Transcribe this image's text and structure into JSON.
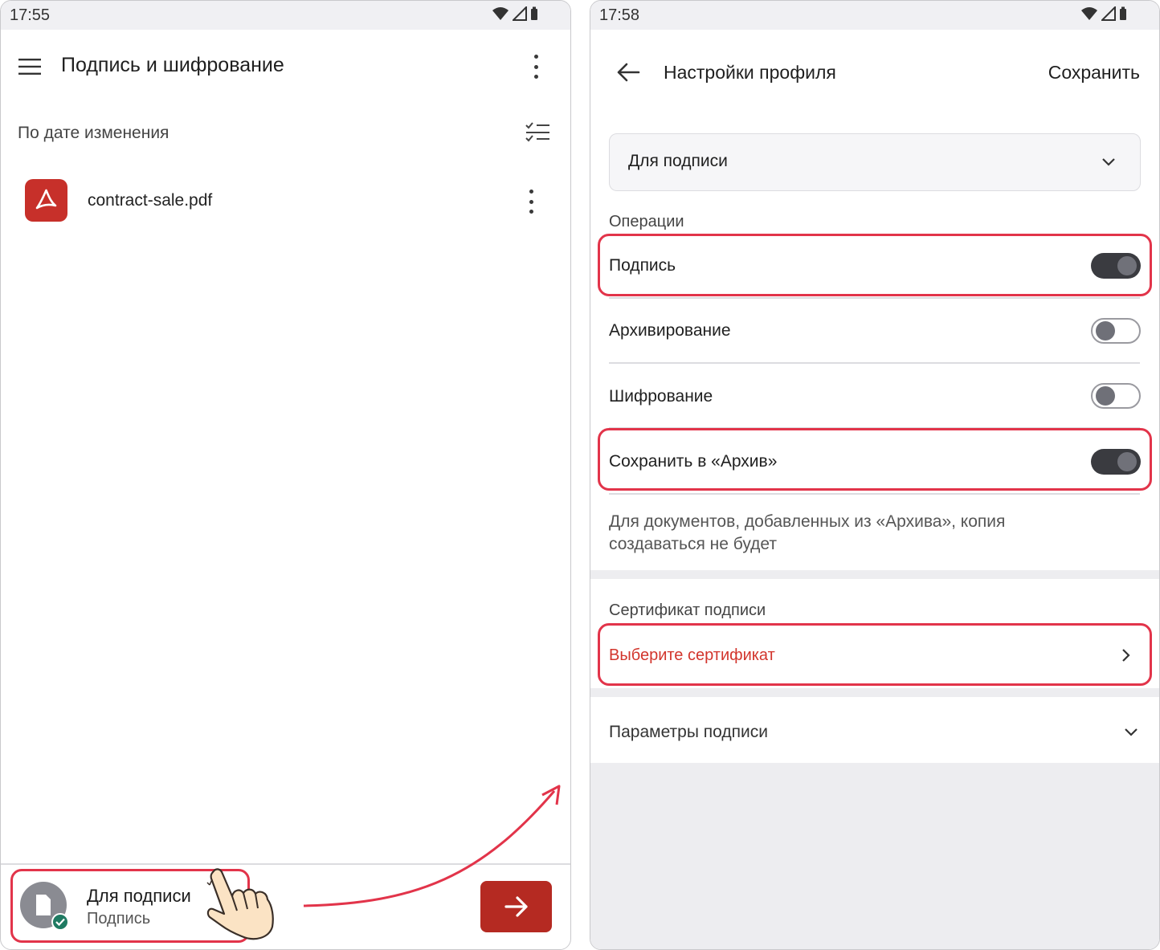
{
  "left": {
    "status_time": "17:55",
    "title": "Подпись и шифрование",
    "sort_label": "По дате изменения",
    "file_name": "contract-sale.pdf",
    "profile_name": "Для подписи",
    "profile_type": "Подпись"
  },
  "right": {
    "status_time": "17:58",
    "title": "Настройки профиля",
    "save_label": "Сохранить",
    "profile_select": "Для подписи",
    "operations_header": "Операции",
    "op_sign": "Подпись",
    "op_sign_enabled": true,
    "op_archive": "Архивирование",
    "op_archive_enabled": false,
    "op_encrypt": "Шифрование",
    "op_encrypt_enabled": false,
    "op_save_archive": "Сохранить в «Архив»",
    "op_save_archive_enabled": true,
    "archive_note_line1": "Для документов, добавленных из «Архива», копия",
    "archive_note_line2": "создаваться не будет",
    "cert_header": "Сертификат подписи",
    "cert_select": "Выберите сертификат",
    "sign_params": "Параметры подписи"
  },
  "colors": {
    "accent_red": "#b52a22",
    "highlight": "#e2344a",
    "toggle_on": "#3a3b40",
    "cert_link": "#d2352c"
  }
}
